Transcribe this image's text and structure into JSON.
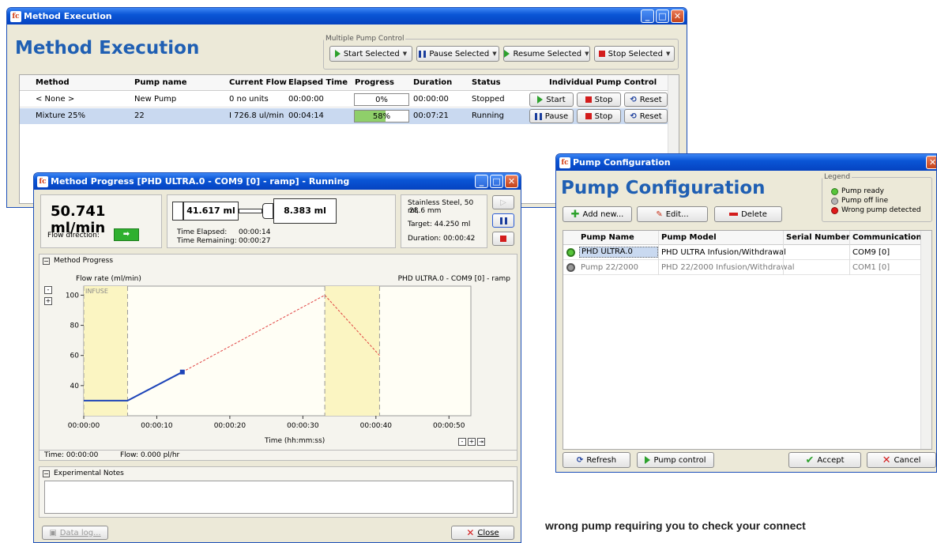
{
  "method_execution": {
    "title": "Method Execution",
    "heading": "Method Execution",
    "group_label": "Multiple Pump Control",
    "multi_buttons": [
      "Start Selected",
      "Pause Selected",
      "Resume Selected",
      "Stop Selected"
    ],
    "columns": [
      "Method",
      "Pump name",
      "Current Flow",
      "Elapsed Time",
      "Progress",
      "Duration",
      "Status",
      "Individual Pump Control"
    ],
    "rows": [
      {
        "method": "< None >",
        "pump": "New Pump",
        "flow": "0 no units",
        "elapsed": "00:00:00",
        "progress": "0%",
        "progress_value": 0,
        "duration": "00:00:00",
        "status": "Stopped",
        "b1": "Start",
        "b2": "Stop",
        "b3": "Reset"
      },
      {
        "method": "Mixture 25%",
        "pump": "22",
        "flow": "I 726.8 ul/min",
        "elapsed": "00:04:14",
        "progress": "58%",
        "progress_value": 0.58,
        "duration": "00:07:21",
        "status": "Running",
        "b1": "Pause",
        "b2": "Stop",
        "b3": "Reset"
      }
    ]
  },
  "method_progress": {
    "title": "Method Progress [PHD ULTRA.0 - COM9 [0] - ramp] - Running",
    "flow_rate": "50.741 ml/min",
    "flow_direction_label": "Flow direction:",
    "syringe_left": "41.617 ml",
    "syringe_right": "8.383 ml",
    "time_elapsed_label": "Time Elapsed:",
    "time_elapsed": "00:00:14",
    "time_remaining_label": "Time Remaining:",
    "time_remaining": "00:00:27",
    "syringe_type": "Stainless Steel, 50 ml,",
    "syringe_diam": "28.6 mm",
    "target": "Target:  44.250 ml",
    "duration": "Duration: 00:00:42",
    "section_progress": "Method Progress",
    "section_notes": "Experimental Notes",
    "status_time": "Time: 00:00:00",
    "status_flow": "Flow: 0.000 pl/hr",
    "data_log": "Data log...",
    "close": "Close"
  },
  "chart_data": {
    "type": "line",
    "ylabel": "Flow rate (ml/min)",
    "xlabel": "Time (hh:mm:ss)",
    "title": "PHD ULTRA.0 - COM9 [0] - ramp",
    "band_label": "INFUSE",
    "xticks": [
      "00:00:00",
      "00:00:10",
      "00:00:20",
      "00:00:30",
      "00:00:40",
      "00:00:50"
    ],
    "yticks": [
      "40",
      "60",
      "80",
      "100"
    ],
    "xlim": [
      0,
      53
    ],
    "ylim": [
      20,
      106
    ],
    "series": [
      {
        "values": [
          [
            0,
            30
          ],
          [
            6,
            30
          ],
          [
            13.5,
            49
          ]
        ]
      },
      {
        "values": [
          [
            13.5,
            49
          ],
          [
            33,
            100
          ],
          [
            40.5,
            60
          ]
        ]
      }
    ],
    "marker": [
      13.5,
      49
    ],
    "bands": [
      [
        0,
        6
      ],
      [
        33,
        40.5
      ]
    ]
  },
  "pump_config": {
    "title": "Pump Configuration",
    "heading": "Pump Configuration",
    "legend_title": "Legend",
    "legend": [
      "Pump ready",
      "Pump off line",
      "Wrong pump detected"
    ],
    "add": "Add new...",
    "edit": "Edit...",
    "delete": "Delete",
    "columns": [
      "Pump Name",
      "Pump Model",
      "Serial Number",
      "Communication"
    ],
    "rows": [
      {
        "name": "PHD ULTRA.0",
        "model": "PHD ULTRA Infusion/Withdrawal",
        "serial": "",
        "comm": "COM9 [0]"
      },
      {
        "name": "Pump 22/2000",
        "model": "PHD 22/2000 Infusion/Withdrawal",
        "serial": "",
        "comm": "COM1 [0]"
      }
    ],
    "refresh": "Refresh",
    "pump_control": "Pump control",
    "accept": "Accept",
    "cancel": "Cancel"
  },
  "caption": "wrong pump requiring you to check your connect",
  "colors": {
    "title_blue": "#1f5fb3",
    "band": "#fbf5c2",
    "selected": "#c9d9f0"
  }
}
